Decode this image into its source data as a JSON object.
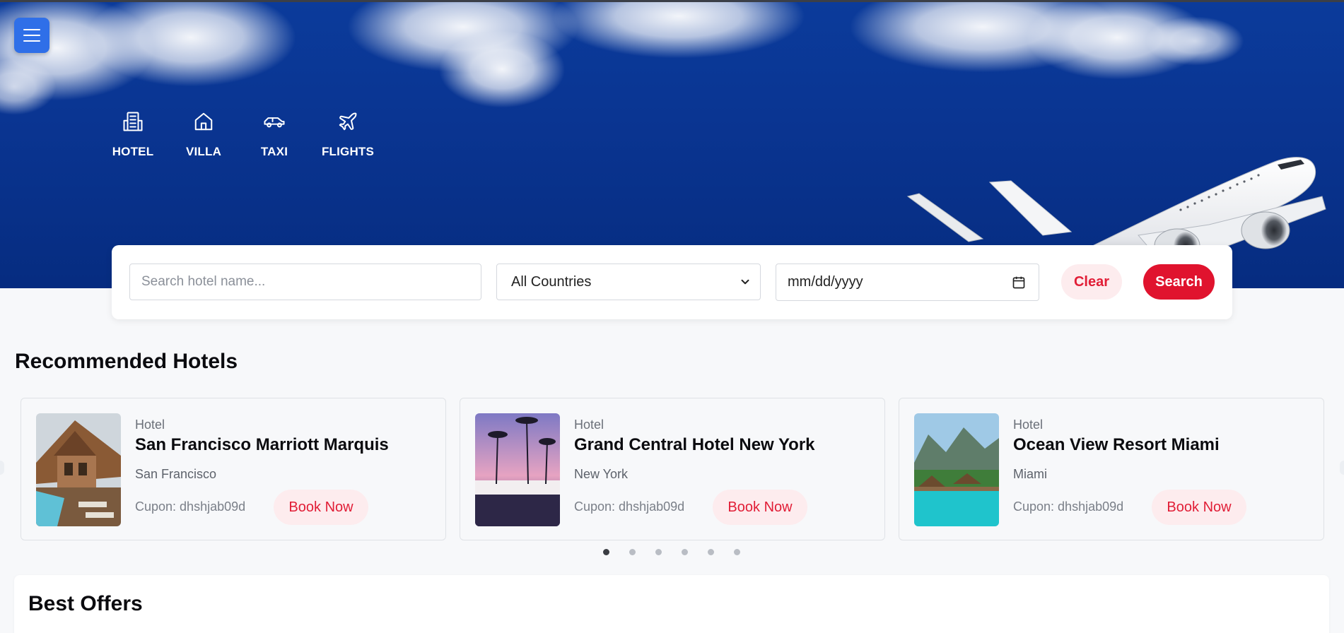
{
  "hero": {
    "menu_icon": "hamburger-menu-icon",
    "categories": [
      {
        "label": "HOTEL",
        "icon": "building-icon"
      },
      {
        "label": "VILLA",
        "icon": "house-icon"
      },
      {
        "label": "TAXI",
        "icon": "car-icon"
      },
      {
        "label": "FLIGHTS",
        "icon": "plane-icon"
      }
    ]
  },
  "search": {
    "hotel_placeholder": "Search hotel name...",
    "country_selected": "All Countries",
    "date_value": "mm/dd/yyyy",
    "clear_label": "Clear",
    "search_label": "Search"
  },
  "recommended": {
    "title": "Recommended Hotels",
    "cards": [
      {
        "kind": "Hotel",
        "name": "San Francisco Marriott Marquis",
        "city": "San Francisco",
        "cupon": "Cupon: dhshjab09d",
        "book_label": "Book Now"
      },
      {
        "kind": "Hotel",
        "name": "Grand Central Hotel New York",
        "city": "New York",
        "cupon": "Cupon: dhshjab09d",
        "book_label": "Book Now"
      },
      {
        "kind": "Hotel",
        "name": "Ocean View Resort Miami",
        "city": "Miami",
        "cupon": "Cupon: dhshjab09d",
        "book_label": "Book Now"
      }
    ],
    "pagination": {
      "total": 6,
      "active": 1
    }
  },
  "offers": {
    "title": "Best Offers"
  },
  "colors": {
    "accent": "#e0132e",
    "accent_soft": "#fdecee",
    "menu_blue": "#2f6fe8",
    "sky": "#0a3592"
  }
}
